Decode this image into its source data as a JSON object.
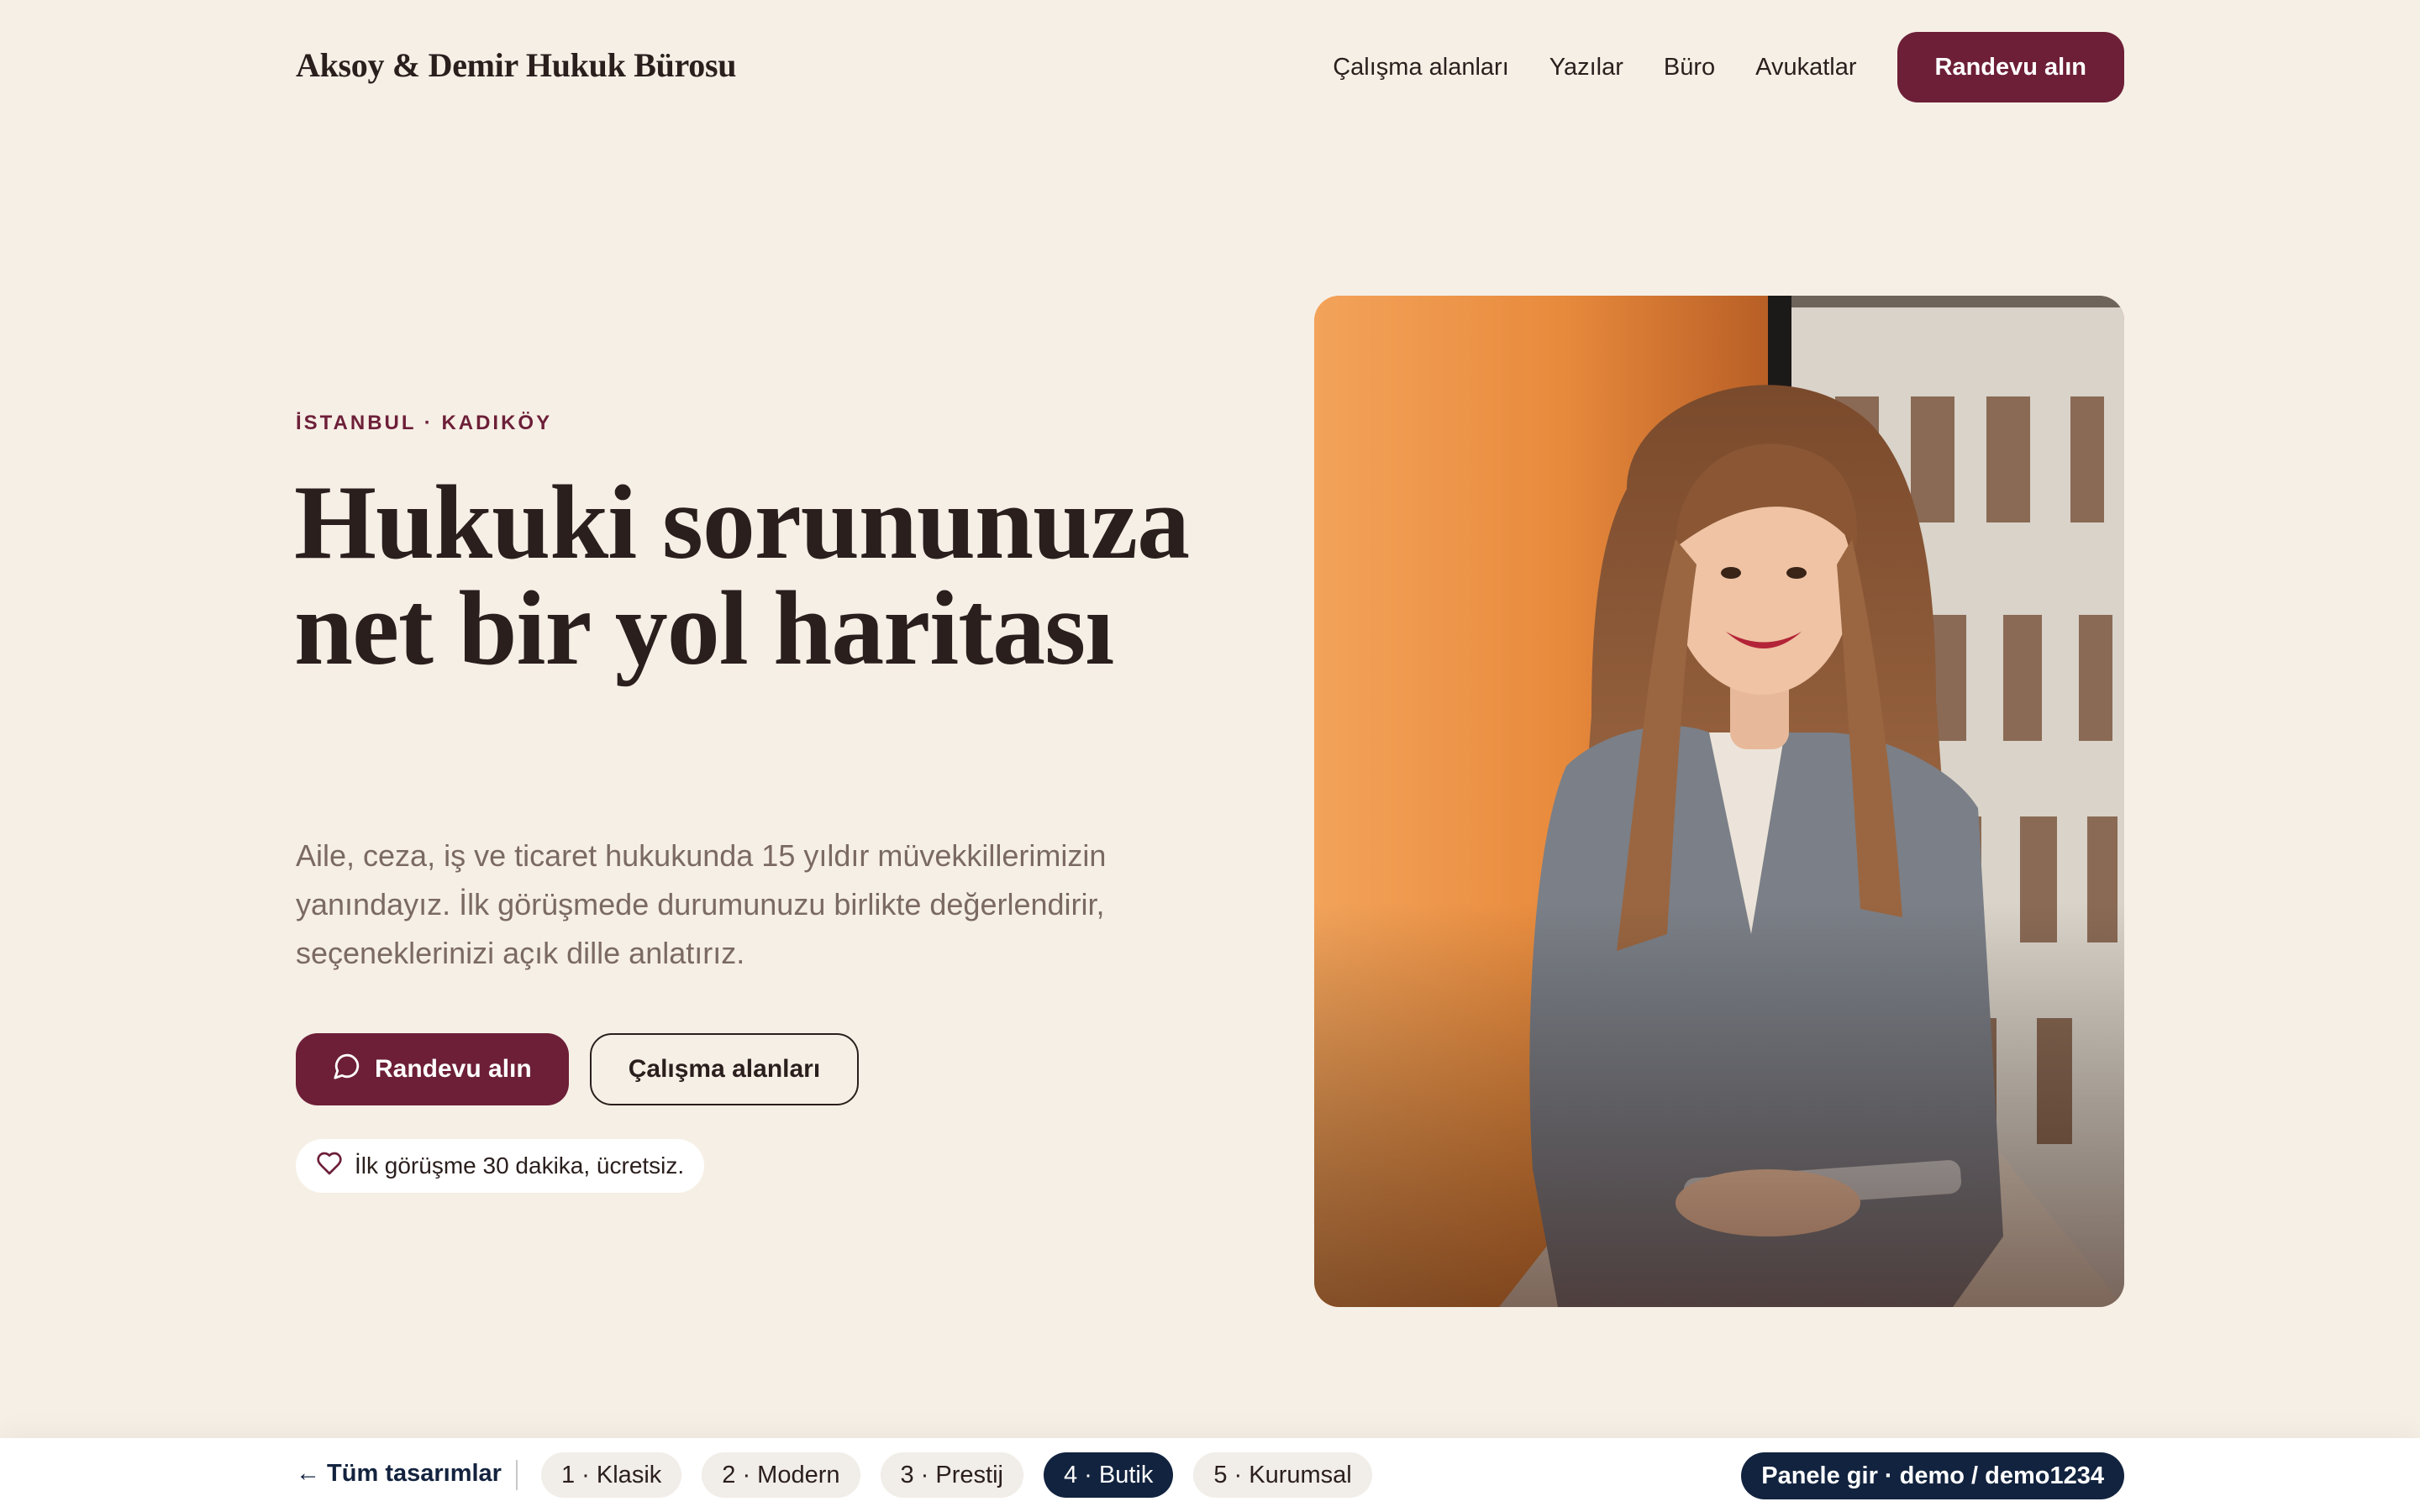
{
  "header": {
    "brand": "Aksoy & Demir Hukuk Bürosu",
    "nav": [
      "Çalışma alanları",
      "Yazılar",
      "Büro",
      "Avukatlar"
    ],
    "cta": "Randevu alın"
  },
  "hero": {
    "eyebrow": "İSTANBUL · KADIKÖY",
    "headline": "Hukuki sorununuza net bir yol haritası",
    "lead": "Aile, ceza, iş ve ticaret hukukunda 15 yıldır müvekkillerimizin yanındayız. İlk görüşmede durumunuzu birlikte değerlendirir, seçeneklerinizi açık dille anlatırız.",
    "primary_button": "Randevu alın",
    "secondary_button": "Çalışma alanları",
    "note": "İlk görüşme 30 dakika, ücretsiz.",
    "icons": {
      "primary": "chat-bubble-icon",
      "note": "heart-icon"
    }
  },
  "bottombar": {
    "back": "← Tüm tasarımlar",
    "tabs": [
      "1 · Klasik",
      "2 · Modern",
      "3 · Prestij",
      "4 · Butik",
      "5 · Kurumsal"
    ],
    "active_tab": "4 · Butik",
    "panel": "Panele gir · demo / demo1234"
  },
  "colors": {
    "background": "#f6efe6",
    "accent": "#6d1f38",
    "navy": "#12233f",
    "text": "#2a1f1d"
  }
}
